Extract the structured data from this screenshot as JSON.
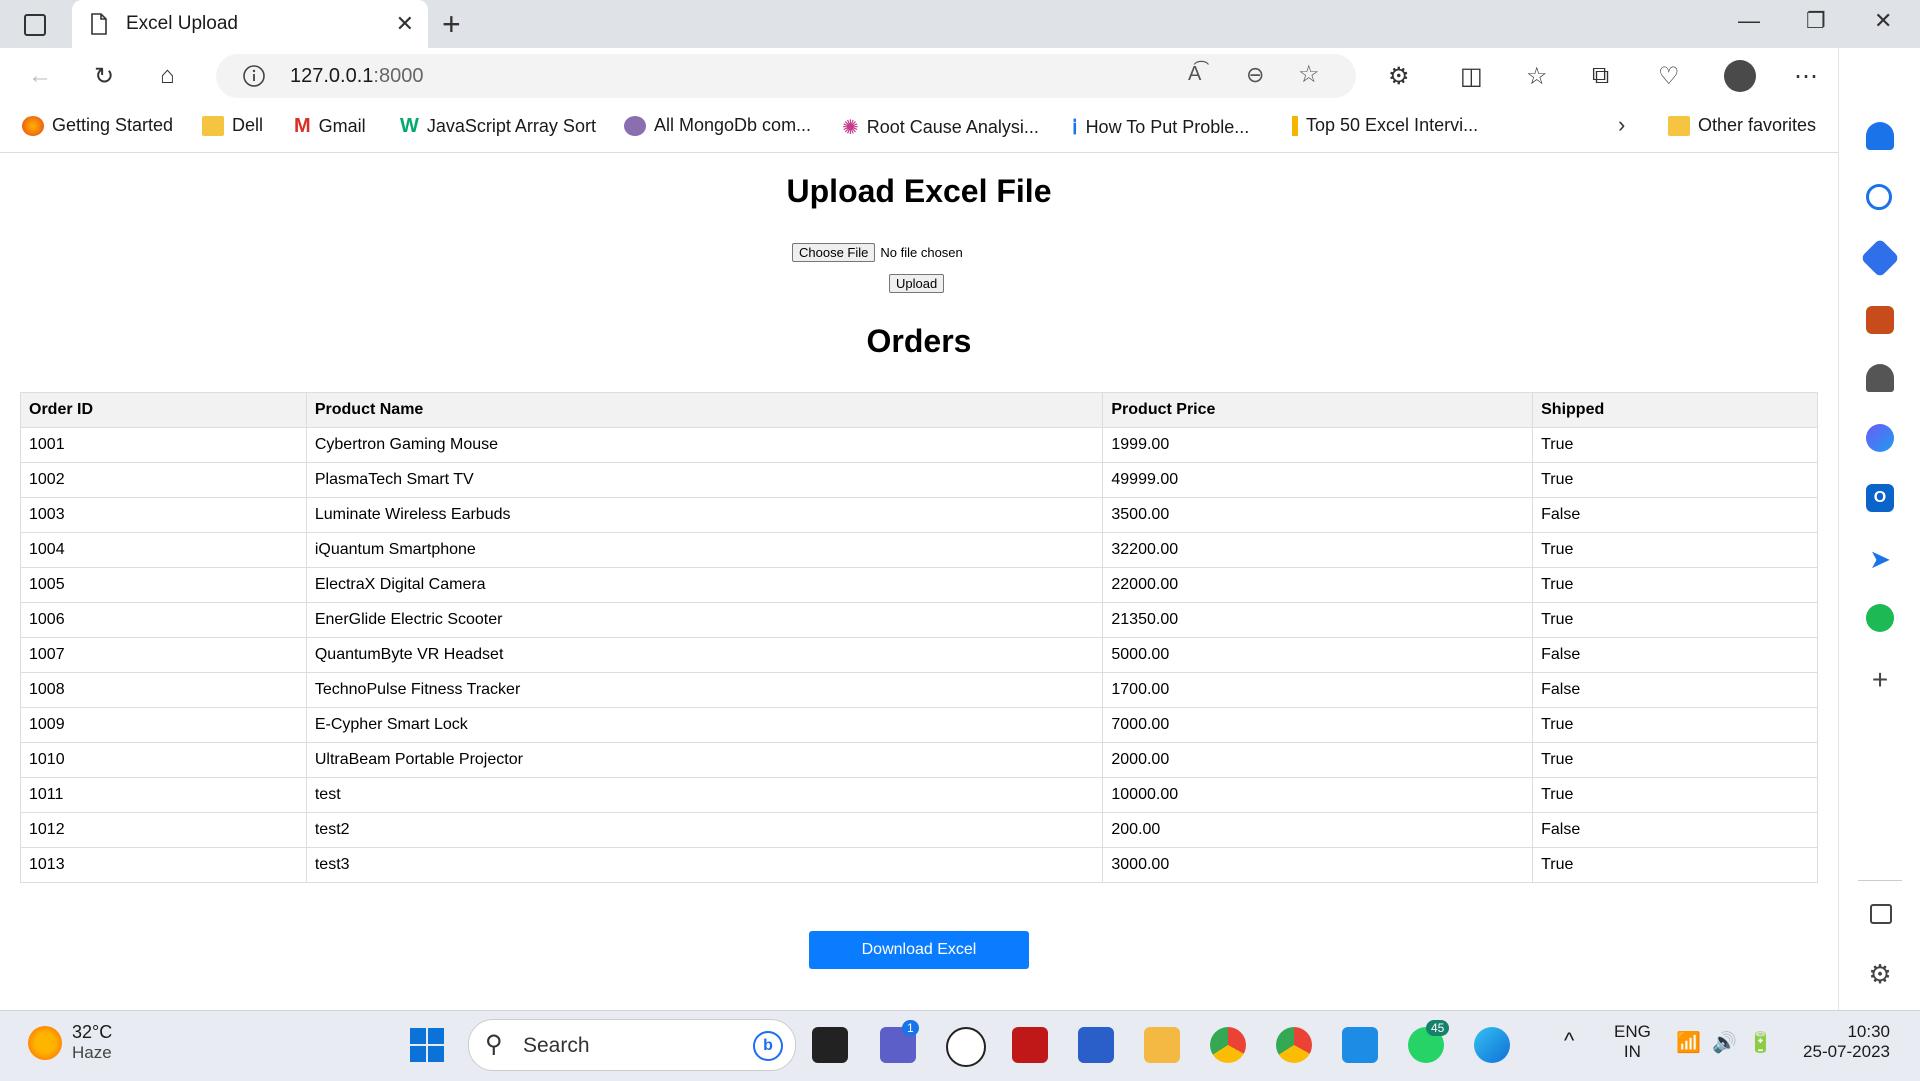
{
  "browser": {
    "tab_title": "Excel Upload",
    "url_host": "127.0.0.1",
    "url_port": ":8000",
    "bookmarks": [
      {
        "label": "Getting Started",
        "icon": "firefox-icon"
      },
      {
        "label": "Dell",
        "icon": "folder-icon"
      },
      {
        "label": "Gmail",
        "icon": "gmail-icon"
      },
      {
        "label": "JavaScript Array Sort",
        "icon": "w3schools-icon"
      },
      {
        "label": "All MongoDb com...",
        "icon": "avatar-icon"
      },
      {
        "label": "Root Cause Analysi...",
        "icon": "dots-icon"
      },
      {
        "label": "How To Put Proble...",
        "icon": "info-icon"
      },
      {
        "label": "Top 50 Excel Intervi...",
        "icon": "chart-icon"
      }
    ],
    "other_favorites": "Other favorites"
  },
  "page": {
    "title": "Upload Excel File",
    "choose_file_label": "Choose File",
    "file_status": "No file chosen",
    "upload_label": "Upload",
    "orders_heading": "Orders",
    "download_label": "Download Excel"
  },
  "table": {
    "headers": [
      "Order ID",
      "Product Name",
      "Product Price",
      "Shipped"
    ],
    "rows": [
      [
        "1001",
        "Cybertron Gaming Mouse",
        "1999.00",
        "True"
      ],
      [
        "1002",
        "PlasmaTech Smart TV",
        "49999.00",
        "True"
      ],
      [
        "1003",
        "Luminate Wireless Earbuds",
        "3500.00",
        "False"
      ],
      [
        "1004",
        "iQuantum Smartphone",
        "32200.00",
        "True"
      ],
      [
        "1005",
        "ElectraX Digital Camera",
        "22000.00",
        "True"
      ],
      [
        "1006",
        "EnerGlide Electric Scooter",
        "21350.00",
        "True"
      ],
      [
        "1007",
        "QuantumByte VR Headset",
        "5000.00",
        "False"
      ],
      [
        "1008",
        "TechnoPulse Fitness Tracker",
        "1700.00",
        "False"
      ],
      [
        "1009",
        "E-Cypher Smart Lock",
        "7000.00",
        "True"
      ],
      [
        "1010",
        "UltraBeam Portable Projector",
        "2000.00",
        "True"
      ],
      [
        "1011",
        "test",
        "10000.00",
        "True"
      ],
      [
        "1012",
        "test2",
        "200.00",
        "False"
      ],
      [
        "1013",
        "test3",
        "3000.00",
        "True"
      ]
    ]
  },
  "taskbar": {
    "temperature": "32°C",
    "weather": "Haze",
    "search_label": "Search",
    "teams_badge": "1",
    "whatsapp_badge": "45",
    "lang_line1": "ENG",
    "lang_line2": "IN",
    "time": "10:30",
    "date": "25-07-2023"
  },
  "colors": {
    "accent": "#0a7cff",
    "header_bg": "#f2f2f2"
  }
}
